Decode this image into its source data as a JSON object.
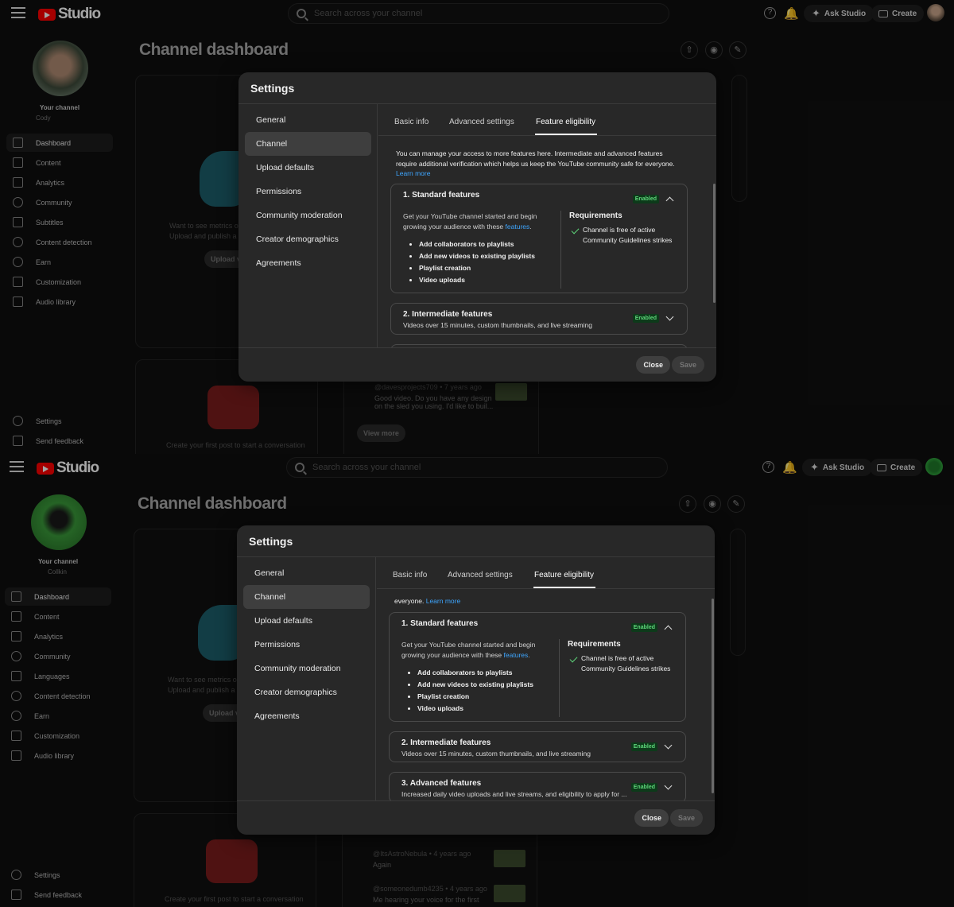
{
  "screens": [
    {
      "topbar": {
        "logo": "Studio",
        "search_placeholder": "Search across your channel",
        "ask_label": "Ask Studio",
        "create_label": "Create"
      },
      "sidebar": {
        "channel_label": "Your channel",
        "channel_name": "Cody",
        "items": [
          {
            "label": "Dashboard"
          },
          {
            "label": "Content"
          },
          {
            "label": "Analytics"
          },
          {
            "label": "Community"
          },
          {
            "label": "Subtitles"
          },
          {
            "label": "Content detection"
          },
          {
            "label": "Earn"
          },
          {
            "label": "Customization"
          },
          {
            "label": "Audio library"
          }
        ],
        "settings": "Settings",
        "feedback": "Send feedback"
      },
      "page_title": "Channel dashboard",
      "background": {
        "metrics_text_1": "Want to see metrics o",
        "metrics_text_2": "Upload and publish a v",
        "upload_btn": "Upload v",
        "post_text": "Create your first post to start a conversation",
        "comment_handle": "@davesprojects709",
        "comment_time": "• 7 years ago",
        "comment_line1": "Good video. Do you have any design",
        "comment_line2": "on the sled you using. I'd like to buil...",
        "view_more": "View more"
      },
      "modal": {
        "title": "Settings",
        "menu": [
          {
            "label": "General"
          },
          {
            "label": "Channel"
          },
          {
            "label": "Upload defaults"
          },
          {
            "label": "Permissions"
          },
          {
            "label": "Community moderation"
          },
          {
            "label": "Creator demographics"
          },
          {
            "label": "Agreements"
          }
        ],
        "tabs": [
          {
            "label": "Basic info"
          },
          {
            "label": "Advanced settings"
          },
          {
            "label": "Feature eligibility"
          }
        ],
        "intro_text": "You can manage your access to more features here. Intermediate and advanced features require additional verification which helps us keep the YouTube community safe for everyone.",
        "learn_more": "Learn more",
        "f1_title": "1. Standard features",
        "f1_badge": "Enabled",
        "f1_desc": "Get your YouTube channel started and begin growing your audience with these",
        "f1_link": "features",
        "f1_items": [
          "Add collaborators to playlists",
          "Add new videos to existing playlists",
          "Playlist creation",
          "Video uploads"
        ],
        "req_title": "Requirements",
        "req_text": "Channel is free of active Community Guidelines strikes",
        "f2_title": "2. Intermediate features",
        "f2_sub": "Videos over 15 minutes, custom thumbnails, and live streaming",
        "f2_badge": "Enabled",
        "close": "Close",
        "save": "Save"
      }
    },
    {
      "topbar": {
        "logo": "Studio",
        "search_placeholder": "Search across your channel",
        "ask_label": "Ask Studio",
        "create_label": "Create"
      },
      "sidebar": {
        "channel_label": "Your channel",
        "channel_name": "Collkin",
        "items": [
          {
            "label": "Dashboard"
          },
          {
            "label": "Content"
          },
          {
            "label": "Analytics"
          },
          {
            "label": "Community"
          },
          {
            "label": "Languages"
          },
          {
            "label": "Content detection"
          },
          {
            "label": "Earn"
          },
          {
            "label": "Customization"
          },
          {
            "label": "Audio library"
          }
        ],
        "settings": "Settings",
        "feedback": "Send feedback"
      },
      "page_title": "Channel dashboard",
      "background": {
        "metrics_text_1": "Want to see metrics o",
        "metrics_text_2": "Upload and publish a v",
        "upload_btn": "Upload v",
        "post_text": "Create your first post to start a conversation",
        "c1_handle": "@ItsAstroNebula",
        "c1_time": "• 4 years ago",
        "c1_text": "Again",
        "c2_handle": "@someonedumb4235",
        "c2_time": "• 4 years ago",
        "c2_text": "Me hearing your voice for the first"
      },
      "modal": {
        "title": "Settings",
        "menu": [
          {
            "label": "General"
          },
          {
            "label": "Channel"
          },
          {
            "label": "Upload defaults"
          },
          {
            "label": "Permissions"
          },
          {
            "label": "Community moderation"
          },
          {
            "label": "Creator demographics"
          },
          {
            "label": "Agreements"
          }
        ],
        "tabs": [
          {
            "label": "Basic info"
          },
          {
            "label": "Advanced settings"
          },
          {
            "label": "Feature eligibility"
          }
        ],
        "intro_tail": "everyone.",
        "learn_more": "Learn more",
        "f1_title": "1. Standard features",
        "f1_badge": "Enabled",
        "f1_desc": "Get your YouTube channel started and begin growing your audience with these",
        "f1_link": "features",
        "f1_items": [
          "Add collaborators to playlists",
          "Add new videos to existing playlists",
          "Playlist creation",
          "Video uploads"
        ],
        "req_title": "Requirements",
        "req_text": "Channel is free of active Community Guidelines strikes",
        "f2_title": "2. Intermediate features",
        "f2_sub": "Videos over 15 minutes, custom thumbnails, and live streaming",
        "f2_badge": "Enabled",
        "f3_title": "3. Advanced features",
        "f3_sub": "Increased daily video uploads and live streams, and eligibility to apply for ...",
        "f3_badge": "Enabled",
        "close": "Close",
        "save": "Save"
      }
    }
  ]
}
